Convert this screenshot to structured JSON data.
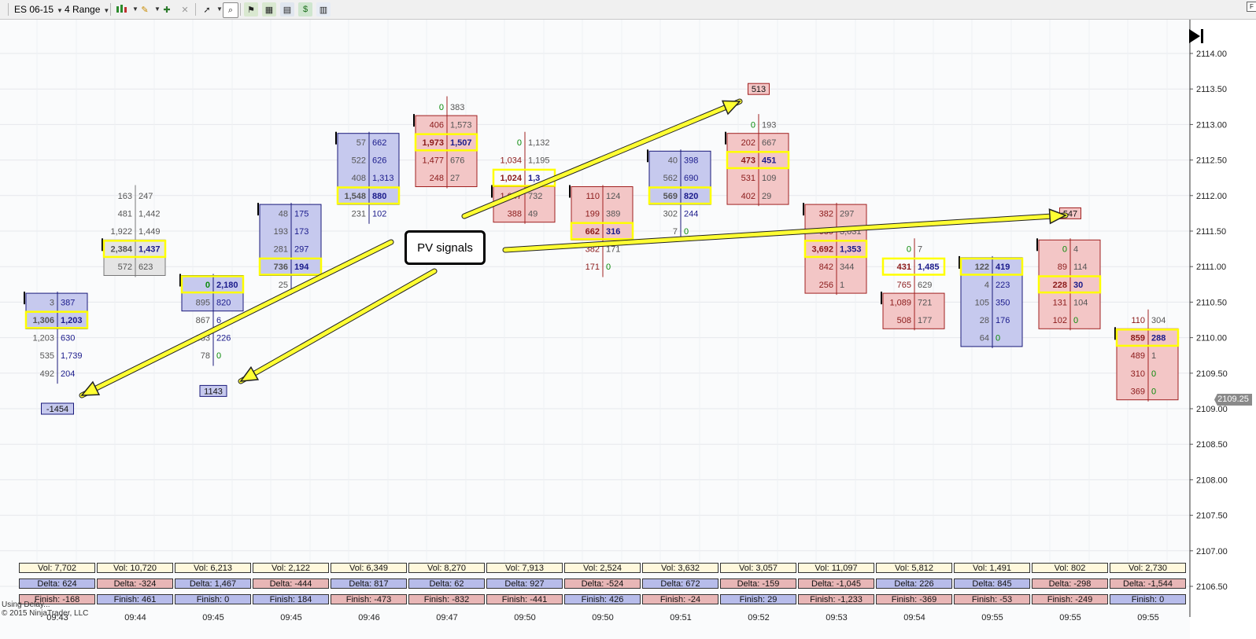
{
  "toolbar": {
    "instrument": "ES 06-15",
    "period": "4 Range",
    "icons": [
      "bar-chart-style-icon",
      "pencil-draw-icon",
      "add-indicator-icon",
      "remove-indicator-icon",
      "pointer-tool-icon",
      "zoom-icon",
      "strategy-icon",
      "analyzer-icon",
      "chart-properties-icon",
      "money-icon",
      "data-box-icon"
    ]
  },
  "colors": {
    "buy_box": "#c6c9ee",
    "sell_box": "#f3c6c6",
    "neutral_box": "#e4e4e4",
    "highlight": "#ffff00",
    "arrow": "#ffff33",
    "bid_text": "#8b1a1a",
    "ask_text": "#1a1a8b",
    "zero_text": "#0a8a0a"
  },
  "price_axis": {
    "labels": [
      "2114.00",
      "2113.50",
      "2113.00",
      "2112.50",
      "2112.00",
      "2111.50",
      "2111.00",
      "2110.50",
      "2110.00",
      "2109.50",
      "2109.00",
      "2108.50",
      "2108.00",
      "2107.50",
      "2107.00",
      "2106.50"
    ],
    "last_price": "2109.25"
  },
  "time_labels": [
    "09:43",
    "09:44",
    "09:45",
    "09:45",
    "09:46",
    "09:47",
    "09:50",
    "09:50",
    "09:51",
    "09:52",
    "09:53",
    "09:54",
    "09:55",
    "09:55",
    "09:55"
  ],
  "bars": [
    {
      "dir": "up",
      "rows": [
        [
          "3",
          "387"
        ],
        [
          "1,306",
          "1,203"
        ],
        [
          "1,203",
          "630"
        ],
        [
          "535",
          "1,739"
        ],
        [
          "492",
          "204"
        ]
      ],
      "box": [
        0,
        1
      ],
      "hl": 1,
      "top_price": 2110.5
    },
    {
      "dir": "neutral",
      "rows": [
        [
          "163",
          "247"
        ],
        [
          "481",
          "1,442"
        ],
        [
          "1,922",
          "1,449"
        ],
        [
          "2,384",
          "1,437"
        ],
        [
          "572",
          "623"
        ]
      ],
      "box": [
        3,
        4
      ],
      "hl": 3,
      "top_price": 2112.0
    },
    {
      "dir": "up",
      "rows": [
        [
          "0",
          "2,180"
        ],
        [
          "895",
          "820"
        ],
        [
          "867",
          "6"
        ],
        [
          "383",
          "226"
        ],
        [
          "78",
          "0"
        ]
      ],
      "box": [
        0,
        1
      ],
      "hl": 0,
      "top_price": 2110.75
    },
    {
      "dir": "up",
      "rows": [
        [
          "48",
          "175"
        ],
        [
          "193",
          "173"
        ],
        [
          "281",
          "297"
        ],
        [
          "736",
          "194"
        ],
        [
          "25",
          ""
        ]
      ],
      "box": [
        0,
        3
      ],
      "hl": 3,
      "top_price": 2111.75
    },
    {
      "dir": "up",
      "rows": [
        [
          "57",
          "662"
        ],
        [
          "522",
          "626"
        ],
        [
          "408",
          "1,313"
        ],
        [
          "1,548",
          "880"
        ],
        [
          "231",
          "102"
        ]
      ],
      "box": [
        0,
        3
      ],
      "hl": 3,
      "top_price": 2112.75
    },
    {
      "dir": "down",
      "rows": [
        [
          "0",
          "383"
        ],
        [
          "406",
          "1,573"
        ],
        [
          "1,973",
          "1,507"
        ],
        [
          "1,477",
          "676"
        ],
        [
          "248",
          "27"
        ]
      ],
      "box": [
        1,
        4
      ],
      "hl": 2,
      "top_price": 2113.25
    },
    {
      "dir": "down",
      "rows": [
        [
          "0",
          "1,132"
        ],
        [
          "1,034",
          "1,195"
        ],
        [
          "1,024",
          "1,3"
        ],
        [
          "1,047",
          "732"
        ],
        [
          "388",
          "49"
        ]
      ],
      "box": [
        3,
        4
      ],
      "hl": 2,
      "top_price": 2112.75
    },
    {
      "dir": "down",
      "rows": [
        [
          "110",
          "124"
        ],
        [
          "199",
          "389"
        ],
        [
          "662",
          "316"
        ],
        [
          "382",
          "171"
        ],
        [
          "171",
          "0"
        ]
      ],
      "box": [
        0,
        2
      ],
      "hl": 2,
      "top_price": 2112.0
    },
    {
      "dir": "up",
      "rows": [
        [
          "40",
          "398"
        ],
        [
          "562",
          "690"
        ],
        [
          "569",
          "820"
        ],
        [
          "302",
          "244"
        ],
        [
          "7",
          "0"
        ]
      ],
      "box": [
        0,
        2
      ],
      "hl": 2,
      "top_price": 2112.5
    },
    {
      "dir": "down",
      "rows": [
        [
          "0",
          "193"
        ],
        [
          "202",
          "667"
        ],
        [
          "473",
          "451"
        ],
        [
          "531",
          "109"
        ],
        [
          "402",
          "29"
        ]
      ],
      "box": [
        1,
        4
      ],
      "hl": 2,
      "top_price": 2113.0
    },
    {
      "dir": "down",
      "rows": [
        [
          "382",
          "297"
        ],
        [
          "689",
          "3,031"
        ],
        [
          "3,692",
          "1,353"
        ],
        [
          "842",
          "344"
        ],
        [
          "256",
          "1"
        ]
      ],
      "box": [
        0,
        4
      ],
      "hl": 2,
      "top_price": 2111.75
    },
    {
      "dir": "down",
      "rows": [
        [
          "0",
          "7"
        ],
        [
          "431",
          "1,485"
        ],
        [
          "765",
          "629"
        ],
        [
          "1,089",
          "721"
        ],
        [
          "508",
          "177"
        ]
      ],
      "box": [
        3,
        4
      ],
      "hl": 1,
      "top_price": 2111.25
    },
    {
      "dir": "up",
      "rows": [
        [
          "122",
          "419"
        ],
        [
          "4",
          "223"
        ],
        [
          "105",
          "350"
        ],
        [
          "28",
          "176"
        ],
        [
          "64",
          "0"
        ]
      ],
      "box": [
        0,
        4
      ],
      "hl": 0,
      "top_price": 2111.0
    },
    {
      "dir": "down",
      "rows": [
        [
          "0",
          "4"
        ],
        [
          "89",
          "114"
        ],
        [
          "228",
          "30"
        ],
        [
          "131",
          "104"
        ],
        [
          "102",
          "0"
        ]
      ],
      "box": [
        0,
        4
      ],
      "hl": 2,
      "top_price": 2111.25
    },
    {
      "dir": "down",
      "rows": [
        [
          "110",
          "304"
        ],
        [
          "859",
          "288"
        ],
        [
          "489",
          "1"
        ],
        [
          "310",
          "0"
        ],
        [
          "369",
          "0"
        ]
      ],
      "box": [
        1,
        4
      ],
      "hl": 1,
      "top_price": 2110.25
    }
  ],
  "markers": [
    {
      "text": "-1454",
      "type": "blue",
      "bar": 0,
      "price": 2109.0
    },
    {
      "text": "1143",
      "type": "blue",
      "bar": 2,
      "price": 2109.25
    },
    {
      "text": "513",
      "type": "red",
      "bar": 9,
      "price": 2113.5
    },
    {
      "text": "547",
      "type": "red",
      "bar": 13,
      "price": 2111.75
    }
  ],
  "summary": {
    "vol_prefix": "Vol:",
    "delta_prefix": "Delta:",
    "finish_prefix": "Finish:",
    "vol": [
      "7,702",
      "10,720",
      "6,213",
      "2,122",
      "6,349",
      "8,270",
      "7,913",
      "2,524",
      "3,632",
      "3,057",
      "11,097",
      "5,812",
      "1,491",
      "802",
      "2,730"
    ],
    "delta": [
      "624",
      "-324",
      "1,467",
      "-444",
      "817",
      "62",
      "927",
      "-524",
      "672",
      "-159",
      "-1,045",
      "226",
      "845",
      "-298",
      "-1,544"
    ],
    "finish": [
      "-168",
      "461",
      "0",
      "184",
      "-473",
      "-832",
      "-441",
      "426",
      "-24",
      "29",
      "-1,233",
      "-369",
      "-53",
      "-249",
      "0"
    ]
  },
  "callout": "PV signals",
  "footer": {
    "line1": "Using Delay...",
    "line2": "© 2015 NinjaTrader, LLC"
  }
}
